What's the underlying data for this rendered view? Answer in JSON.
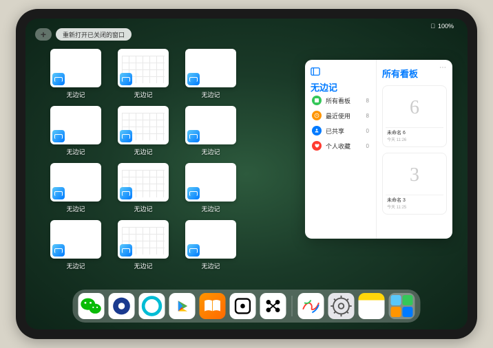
{
  "status": {
    "battery": "100%",
    "wifi": "●"
  },
  "topControls": {
    "plus": "+",
    "reopenLabel": "重新打开已关闭的窗口"
  },
  "grid": {
    "appLabel": "无边记",
    "tiles": [
      {
        "type": "blank"
      },
      {
        "type": "calendar"
      },
      {
        "type": "stacked"
      },
      {
        "type": "blank"
      },
      {
        "type": "calendar"
      },
      {
        "type": "stacked"
      },
      {
        "type": "blank"
      },
      {
        "type": "calendar"
      },
      {
        "type": "stacked"
      },
      {
        "type": "blank"
      },
      {
        "type": "calendar"
      },
      {
        "type": "stacked"
      }
    ]
  },
  "sidePanel": {
    "leftTitle": "无边记",
    "rightTitle": "所有看板",
    "items": [
      {
        "label": "所有看板",
        "count": "8",
        "color": "#34c759",
        "icon": "boards"
      },
      {
        "label": "最近使用",
        "count": "8",
        "color": "#ff9500",
        "icon": "clock"
      },
      {
        "label": "已共享",
        "count": "0",
        "color": "#007aff",
        "icon": "share"
      },
      {
        "label": "个人收藏",
        "count": "0",
        "color": "#ff3b30",
        "icon": "heart"
      }
    ],
    "boards": [
      {
        "name": "未命名 6",
        "time": "今天 11:26",
        "glyph": "6"
      },
      {
        "name": "未命名 3",
        "time": "今天 11:25",
        "glyph": "3"
      }
    ],
    "more": "⋯"
  },
  "dock": {
    "icons": [
      {
        "name": "wechat",
        "bg": "#ffffff",
        "svg": "wechat"
      },
      {
        "name": "browser-blue",
        "bg": "#ffffff",
        "svg": "circle-blue"
      },
      {
        "name": "qq-browser",
        "bg": "#ffffff",
        "svg": "circle-cyan"
      },
      {
        "name": "play",
        "bg": "#ffffff",
        "svg": "play"
      },
      {
        "name": "books",
        "bg": "linear-gradient(135deg,#ff9500,#ff6a00)",
        "svg": "books"
      },
      {
        "name": "dice",
        "bg": "#ffffff",
        "svg": "dice"
      },
      {
        "name": "dots",
        "bg": "#ffffff",
        "svg": "dots"
      }
    ],
    "recentIcons": [
      {
        "name": "freeform",
        "bg": "#ffffff",
        "svg": "freeform"
      },
      {
        "name": "settings",
        "bg": "#e5e5ea",
        "svg": "gear"
      },
      {
        "name": "notes",
        "bg": "linear-gradient(to bottom,#ffd60a 0% 28%,#fff 28% 100%)",
        "svg": ""
      }
    ],
    "cluster": [
      "#5ac8fa",
      "#34c759",
      "#ff9500",
      "#007aff"
    ]
  }
}
